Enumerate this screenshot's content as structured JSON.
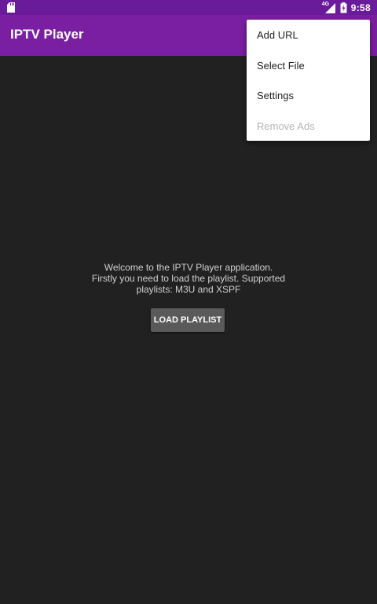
{
  "status_bar": {
    "time": "9:58",
    "network": "4G",
    "icons": [
      "sd-card-icon",
      "cellular-signal-icon",
      "battery-icon"
    ]
  },
  "app_bar": {
    "title": "IPTV Player"
  },
  "main": {
    "welcome_text": "Welcome to the IPTV Player application.\nFirstly you need to load the playlist. Supported\nplaylists: M3U and XSPF",
    "load_button_label": "LOAD PLAYLIST"
  },
  "menu": {
    "items": [
      {
        "label": "Add URL",
        "enabled": true
      },
      {
        "label": "Select File",
        "enabled": true
      },
      {
        "label": "Settings",
        "enabled": true
      },
      {
        "label": "Remove Ads",
        "enabled": false
      }
    ]
  },
  "colors": {
    "status_bar": "#6a1b9a",
    "app_bar": "#7b1fa2",
    "background": "#212121",
    "button": "#5a5a5a",
    "menu_background": "#ffffff"
  }
}
